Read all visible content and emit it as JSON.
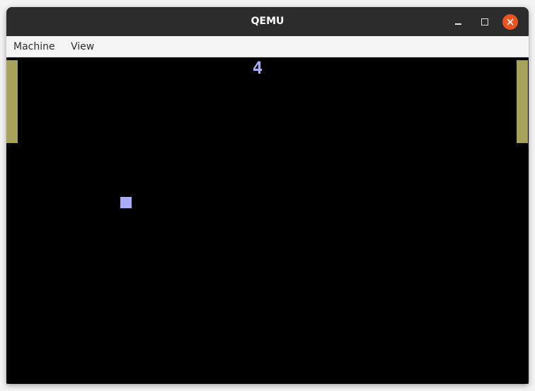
{
  "window": {
    "title": "QEMU"
  },
  "menu": {
    "items": [
      "Machine",
      "View"
    ]
  },
  "game": {
    "score": "4"
  },
  "colors": {
    "titlebar": "#2c2c2c",
    "close_button": "#e95420",
    "paddle": "#a8a35a",
    "ball": "#a8acf8",
    "score": "#a8acf8",
    "screen": "#000000"
  },
  "icons": {
    "minimize": "minimize-icon",
    "maximize": "maximize-icon",
    "close": "close-icon"
  }
}
